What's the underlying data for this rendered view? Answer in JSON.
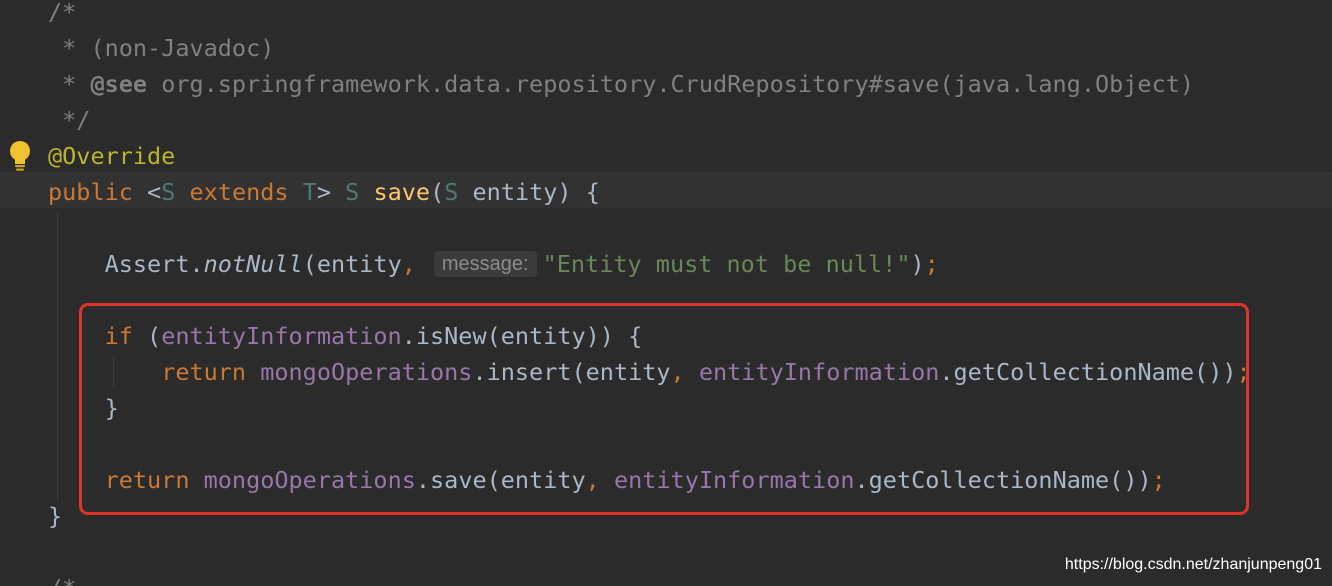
{
  "editor": {
    "language": "java",
    "colors": {
      "background": "#2b2b2b",
      "caret_row": "#323232",
      "comment": "#808080",
      "annotation": "#bbb529",
      "keyword": "#cc7832",
      "type_param": "#507874",
      "method_decl": "#ffc66d",
      "field": "#9876aa",
      "identifier": "#a9b7c6",
      "string": "#6a8759",
      "highlight_border": "#e0342b"
    },
    "gutter": {
      "intention_icon": "lightbulb-icon"
    },
    "lines": [
      {
        "tokens": [
          {
            "t": "/*",
            "c": "comment"
          }
        ]
      },
      {
        "tokens": [
          {
            "t": " * (non-Javadoc)",
            "c": "comment"
          }
        ]
      },
      {
        "tokens": [
          {
            "t": " * ",
            "c": "comment"
          },
          {
            "t": "@see",
            "c": "doctag"
          },
          {
            "t": " org.springframework.data.repository.CrudRepository#save(java.lang.Object)",
            "c": "comment"
          }
        ]
      },
      {
        "tokens": [
          {
            "t": " */",
            "c": "comment"
          }
        ]
      },
      {
        "tokens": [
          {
            "t": "@Override",
            "c": "annotation"
          }
        ]
      },
      {
        "tokens": [
          {
            "t": "public",
            "c": "keyword"
          },
          {
            "t": " <",
            "c": "punct"
          },
          {
            "t": "S",
            "c": "typeparam"
          },
          {
            "t": " ",
            "c": "punct"
          },
          {
            "t": "extends",
            "c": "keyword"
          },
          {
            "t": " ",
            "c": "punct"
          },
          {
            "t": "T",
            "c": "typeparam"
          },
          {
            "t": "> ",
            "c": "punct"
          },
          {
            "t": "S",
            "c": "typeparam"
          },
          {
            "t": " ",
            "c": "punct"
          },
          {
            "t": "save",
            "c": "method"
          },
          {
            "t": "(",
            "c": "punct"
          },
          {
            "t": "S",
            "c": "typeparam"
          },
          {
            "t": " entity) {",
            "c": "punct"
          }
        ]
      },
      {
        "tokens": []
      },
      {
        "tokens": [
          {
            "t": "    Assert.",
            "c": "ident"
          },
          {
            "t": "notNull",
            "c": "italic"
          },
          {
            "t": "(entity",
            "c": "ident"
          },
          {
            "t": ",",
            "c": "punct-kw"
          },
          {
            "t": "message:",
            "c": "hint"
          },
          {
            "t": "\"Entity must not be null!\"",
            "c": "string"
          },
          {
            "t": ")",
            "c": "ident"
          },
          {
            "t": ";",
            "c": "punct-kw"
          }
        ]
      },
      {
        "tokens": []
      },
      {
        "tokens": [
          {
            "t": "    ",
            "c": "ident"
          },
          {
            "t": "if",
            "c": "keyword"
          },
          {
            "t": " (",
            "c": "ident"
          },
          {
            "t": "entityInformation",
            "c": "field"
          },
          {
            "t": ".isNew(entity)) {",
            "c": "ident"
          }
        ]
      },
      {
        "tokens": [
          {
            "t": "        ",
            "c": "ident"
          },
          {
            "t": "return",
            "c": "keyword"
          },
          {
            "t": " ",
            "c": "ident"
          },
          {
            "t": "mongoOperations",
            "c": "field"
          },
          {
            "t": ".insert(entity",
            "c": "ident"
          },
          {
            "t": ",",
            "c": "punct-kw"
          },
          {
            "t": " ",
            "c": "ident"
          },
          {
            "t": "entityInformation",
            "c": "field"
          },
          {
            "t": ".getCollectionName())",
            "c": "ident"
          },
          {
            "t": ";",
            "c": "punct-kw"
          }
        ]
      },
      {
        "tokens": [
          {
            "t": "    }",
            "c": "ident"
          }
        ]
      },
      {
        "tokens": []
      },
      {
        "tokens": [
          {
            "t": "    ",
            "c": "ident"
          },
          {
            "t": "return",
            "c": "keyword"
          },
          {
            "t": " ",
            "c": "ident"
          },
          {
            "t": "mongoOperations",
            "c": "field"
          },
          {
            "t": ".save(entity",
            "c": "ident"
          },
          {
            "t": ",",
            "c": "punct-kw"
          },
          {
            "t": " ",
            "c": "ident"
          },
          {
            "t": "entityInformation",
            "c": "field"
          },
          {
            "t": ".getCollectionName())",
            "c": "ident"
          },
          {
            "t": ";",
            "c": "punct-kw"
          }
        ]
      },
      {
        "tokens": [
          {
            "t": "}",
            "c": "ident"
          }
        ]
      },
      {
        "tokens": []
      },
      {
        "tokens": [
          {
            "t": "/*",
            "c": "comment"
          }
        ]
      }
    ]
  },
  "watermark": {
    "text": "https://blog.csdn.net/zhanjunpeng01"
  }
}
